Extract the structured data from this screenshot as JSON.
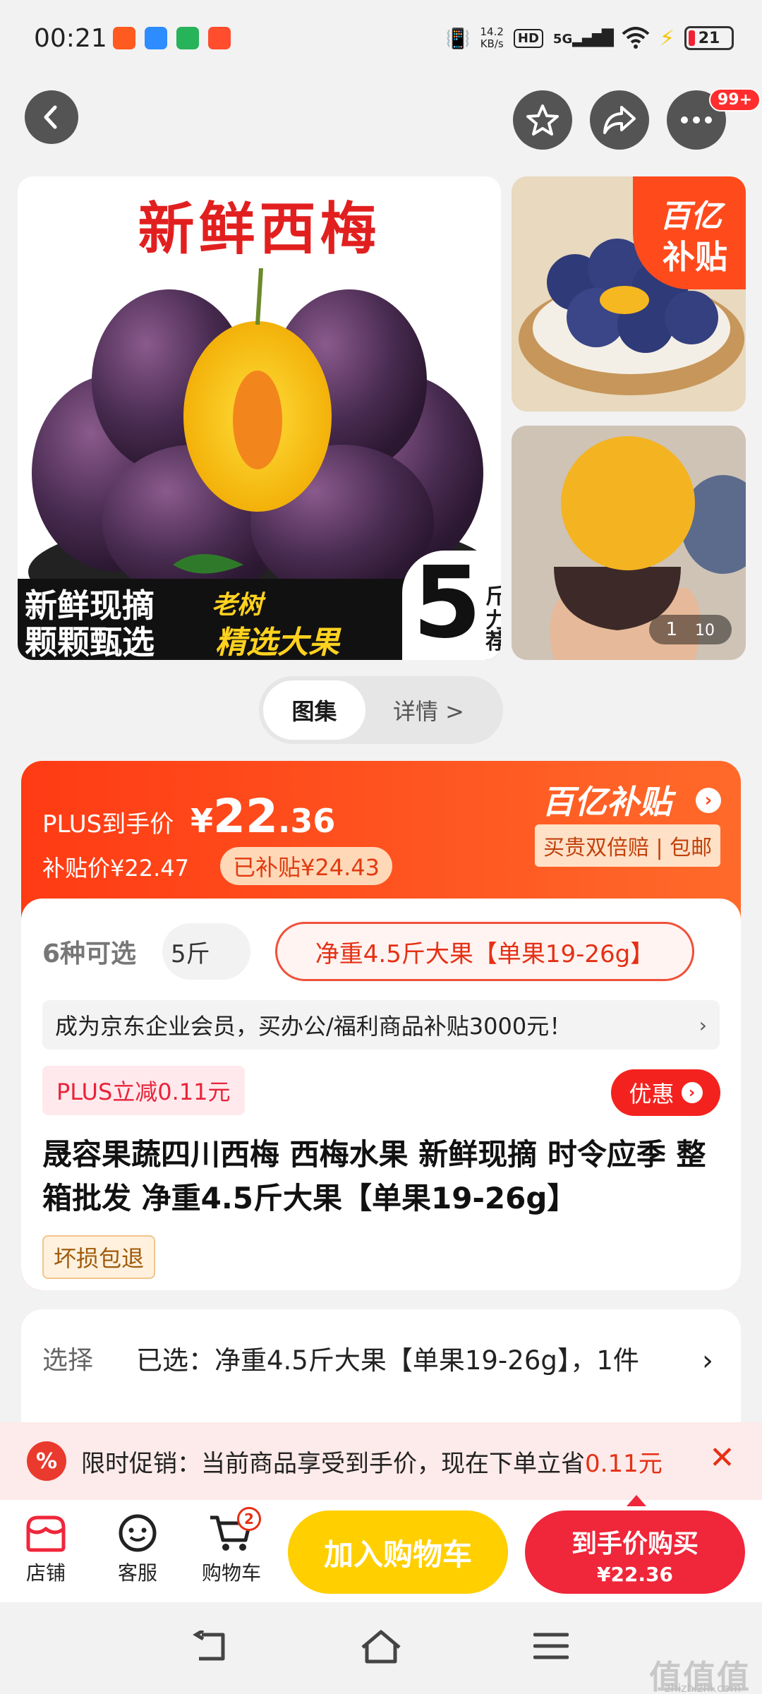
{
  "status_bar": {
    "time": "00:21",
    "net_speed": "14.2",
    "net_unit": "KB/s",
    "hd": "HD",
    "signal": "5G",
    "battery": "21"
  },
  "gallery": {
    "main_title": "新鲜西梅",
    "banner_line1": "新鲜现摘",
    "banner_line2": "颗颗甄选",
    "banner_tag1": "老树",
    "banner_tag2": "精选大果",
    "weight_num": "5",
    "weight_unit": "斤",
    "weight_note": "力荐",
    "corner_line1": "百亿",
    "corner_line2": "补贴",
    "counter_current": "1",
    "counter_total": "10"
  },
  "nav": {
    "badge": "99+"
  },
  "tabs": {
    "gallery": "图集",
    "details": "详情 >"
  },
  "price": {
    "plus_label": "PLUS到手价",
    "currency": "¥",
    "amount_int": "22",
    "amount_dec": ".36",
    "subsidy_price": "补贴价¥22.47",
    "subsidy_tag": "已补贴¥24.43",
    "brand": "百亿补贴",
    "guarantee": "买贵双倍赔 | 包邮"
  },
  "options": {
    "count_label": "6种可选",
    "chip1": "5斤",
    "chip2": "净重4.5斤大果【单果19-26g】"
  },
  "promo_strip": "成为京东企业会员，买办公/福利商品补贴3000元！",
  "plus_discount": "PLUS立减0.11元",
  "discount_button": "优惠",
  "product_title": "晟容果蔬四川西梅 西梅水果 新鲜现摘 时令应季 整箱批发 净重4.5斤大果【单果19-26g】",
  "return_tag": "坏损包退",
  "select": {
    "label": "选择",
    "value": "已选：净重4.5斤大果【单果19-26g】，1件"
  },
  "promo_bar": {
    "text": "限时促销：当前商品享受到手价，现在下单立省",
    "amount": "0.11元"
  },
  "bottom_bar": {
    "store": "店铺",
    "service": "客服",
    "cart": "购物车",
    "cart_count": "2",
    "add_to_cart": "加入购物车",
    "buy_label": "到手价购买",
    "buy_price": "¥22.36"
  },
  "watermark": {
    "logo": "值值值",
    "url": "zhizhizhi.com"
  },
  "colors": {
    "accent_red": "#ff3b14",
    "cart_yellow": "#ffcf00",
    "buy_red": "#f0263a"
  }
}
